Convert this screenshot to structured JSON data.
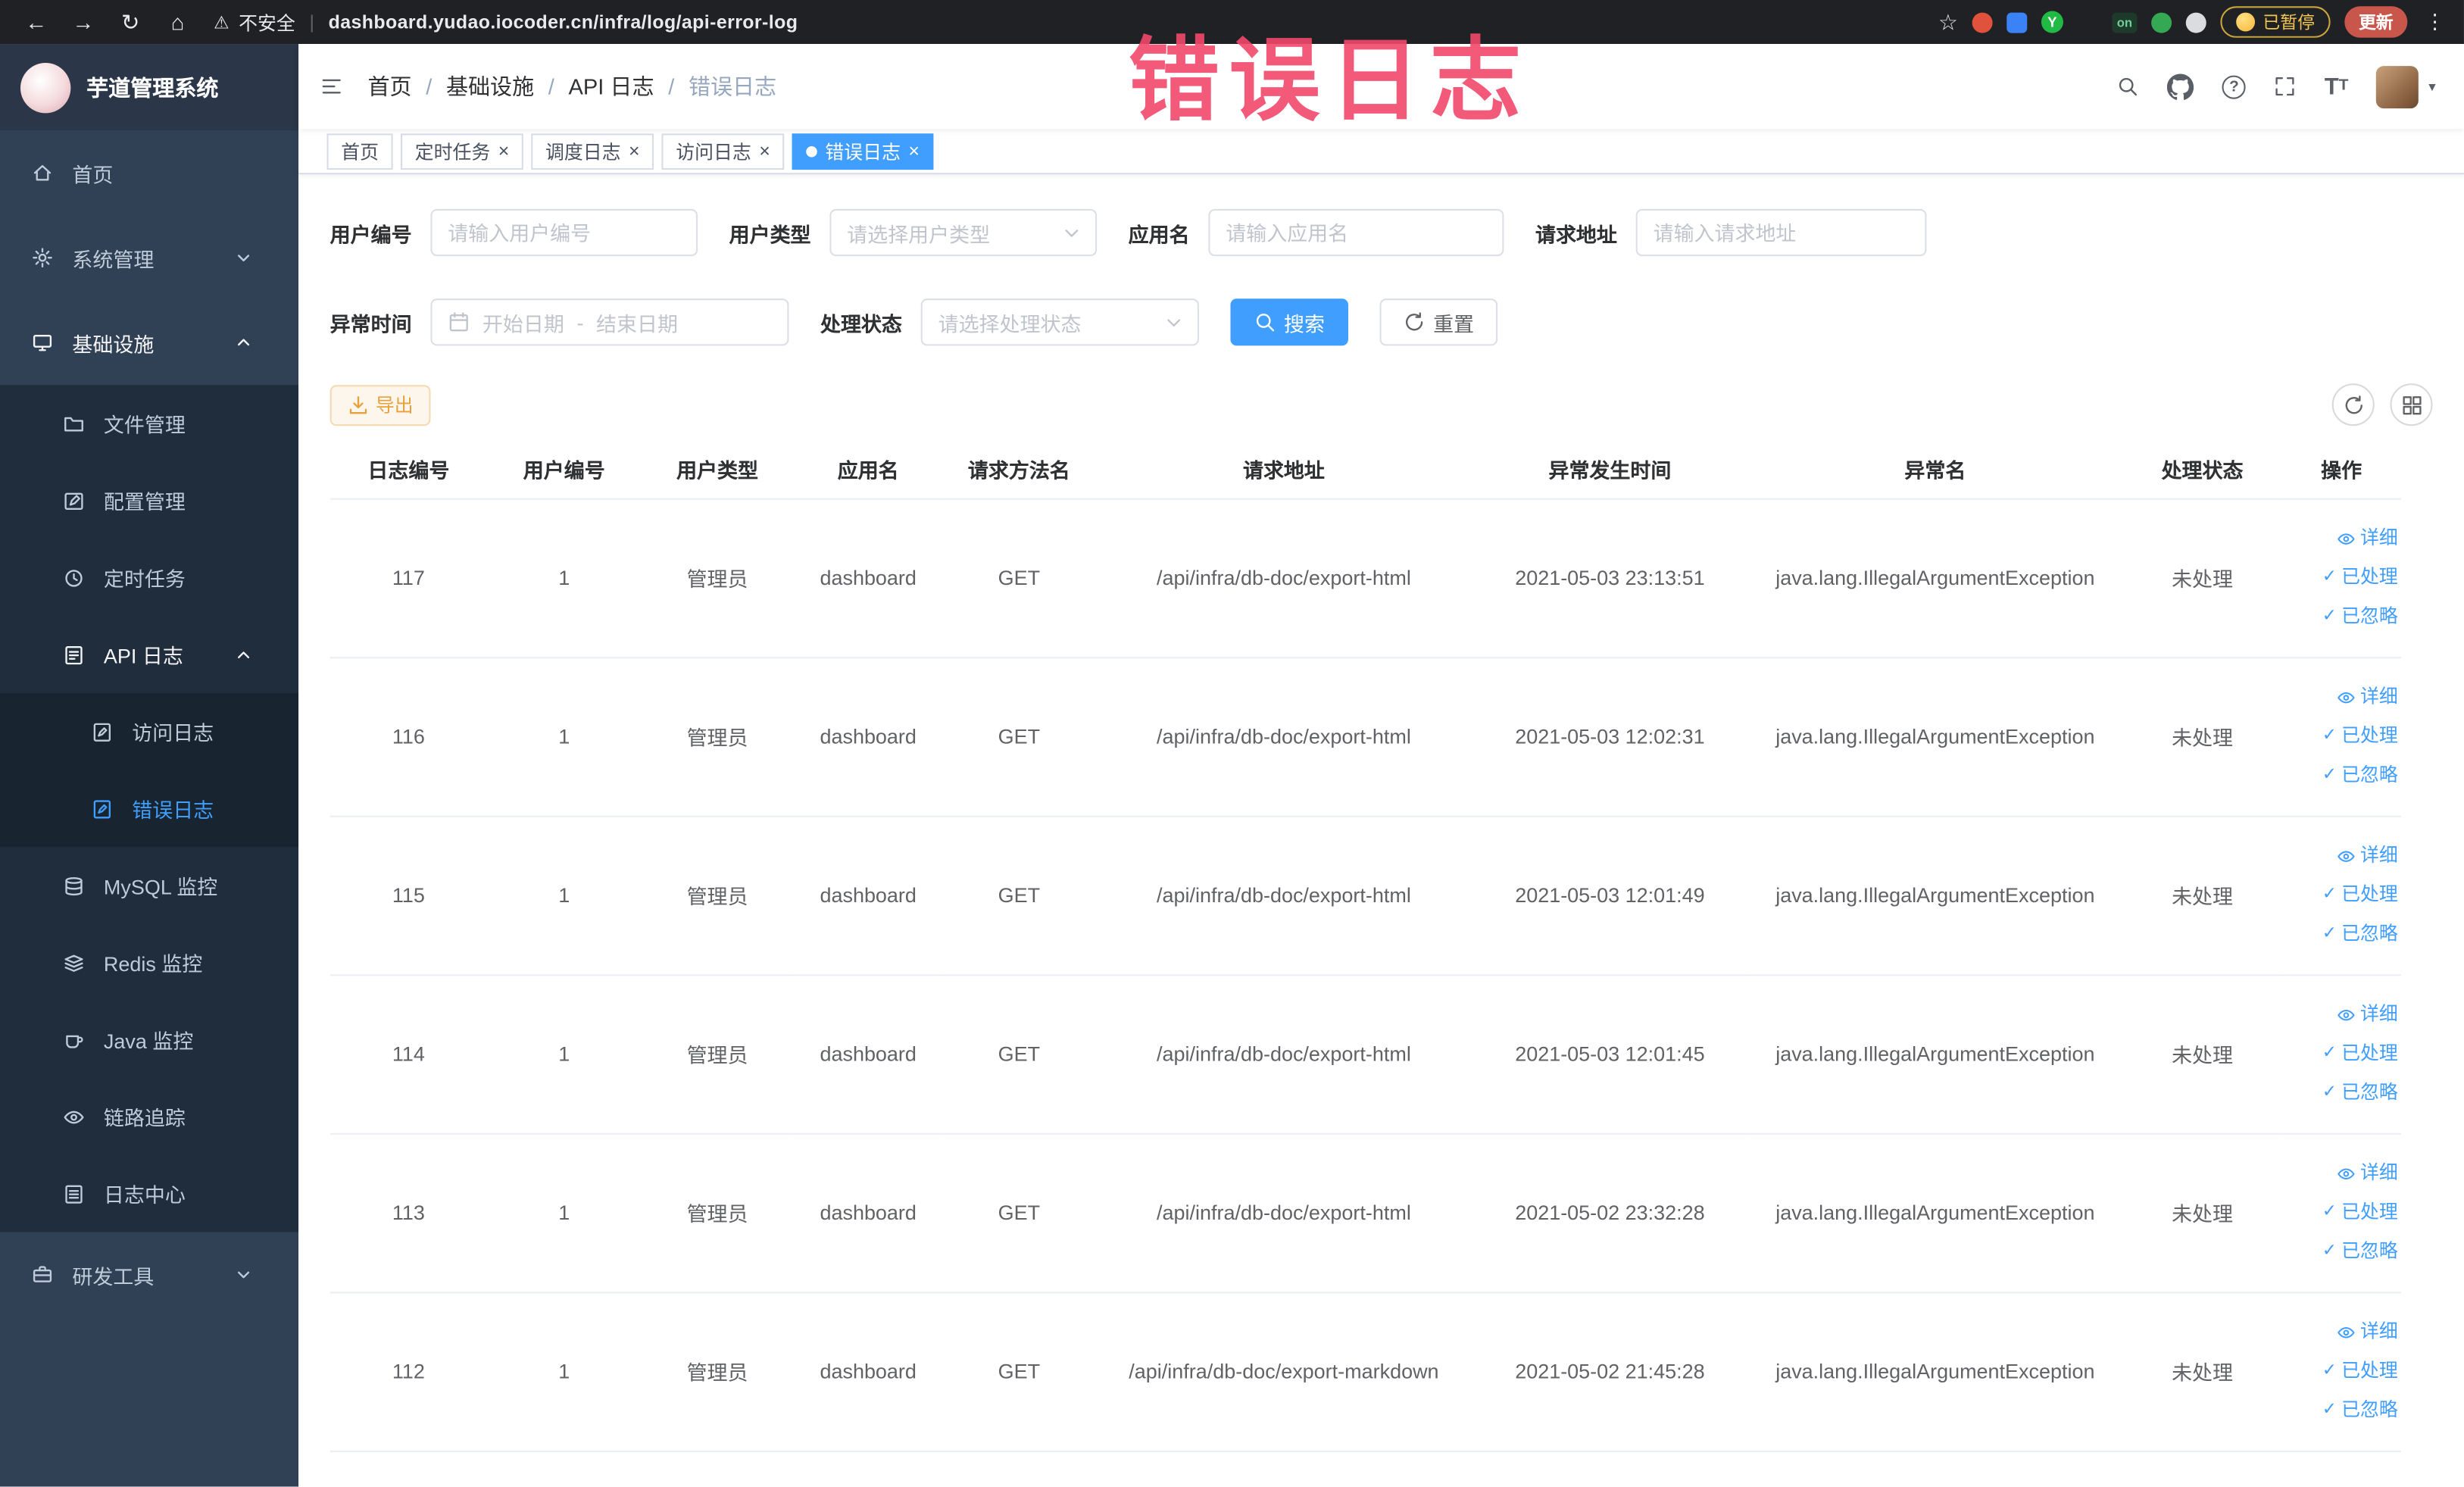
{
  "watermark": "错误日志",
  "colors": {
    "accent": "#409eff",
    "warning": "#e6a23c",
    "sidebar_bg": "#304156",
    "watermark": "#f2486c",
    "tag_active": "#409eff"
  },
  "browser": {
    "security": "不安全",
    "url": "dashboard.yudao.iocoder.cn/infra/log/api-error-log",
    "paused": "已暂停",
    "update": "更新"
  },
  "icons": {
    "back": "←",
    "forward": "→",
    "refresh": "↻",
    "home": "⌂",
    "warning": "⚠",
    "star": "☆",
    "menu": "⋮",
    "close": "×",
    "check": "✓",
    "on_badge": "on",
    "yudao_letter": "Y",
    "breadcrumb_separator": "/",
    "caret": "▾",
    "question": "?",
    "font_size": "T"
  },
  "app": {
    "logo_title": "芋道管理系统",
    "breadcrumb": [
      "首页",
      "基础设施",
      "API 日志",
      "错误日志"
    ]
  },
  "sidebar": {
    "items": [
      {
        "label": "首页"
      },
      {
        "label": "系统管理"
      },
      {
        "label": "基础设施"
      },
      {
        "label": "文件管理"
      },
      {
        "label": "配置管理"
      },
      {
        "label": "定时任务"
      },
      {
        "label": "API 日志"
      },
      {
        "label": "访问日志"
      },
      {
        "label": "错误日志"
      },
      {
        "label": "MySQL 监控"
      },
      {
        "label": "Redis 监控"
      },
      {
        "label": "Java 监控"
      },
      {
        "label": "链路追踪"
      },
      {
        "label": "日志中心"
      },
      {
        "label": "研发工具"
      }
    ]
  },
  "tabs": [
    {
      "label": "首页"
    },
    {
      "label": "定时任务"
    },
    {
      "label": "调度日志"
    },
    {
      "label": "访问日志"
    },
    {
      "label": "错误日志"
    }
  ],
  "filters": {
    "user_id_label": "用户编号",
    "user_id_placeholder": "请输入用户编号",
    "user_type_label": "用户类型",
    "user_type_placeholder": "请选择用户类型",
    "app_name_label": "应用名",
    "app_name_placeholder": "请输入应用名",
    "request_url_label": "请求地址",
    "request_url_placeholder": "请输入请求地址",
    "exception_time_label": "异常时间",
    "date_start_placeholder": "开始日期",
    "date_separator": "-",
    "date_end_placeholder": "结束日期",
    "process_status_label": "处理状态",
    "process_status_placeholder": "请选择处理状态",
    "search_button": "搜索",
    "reset_button": "重置"
  },
  "toolbar": {
    "export_button": "导出"
  },
  "table": {
    "columns": [
      "日志编号",
      "用户编号",
      "用户类型",
      "应用名",
      "请求方法名",
      "请求地址",
      "异常发生时间",
      "异常名",
      "处理状态",
      "操作"
    ],
    "actions": {
      "detail": "详细",
      "processed": "已处理",
      "ignored": "已忽略"
    },
    "rows": [
      {
        "id": "117",
        "user_id": "1",
        "user_type": "管理员",
        "app": "dashboard",
        "method": "GET",
        "url": "/api/infra/db-doc/export-html",
        "time": "2021-05-03 23:13:51",
        "exception": "java.lang.IllegalArgumentException",
        "status": "未处理"
      },
      {
        "id": "116",
        "user_id": "1",
        "user_type": "管理员",
        "app": "dashboard",
        "method": "GET",
        "url": "/api/infra/db-doc/export-html",
        "time": "2021-05-03 12:02:31",
        "exception": "java.lang.IllegalArgumentException",
        "status": "未处理"
      },
      {
        "id": "115",
        "user_id": "1",
        "user_type": "管理员",
        "app": "dashboard",
        "method": "GET",
        "url": "/api/infra/db-doc/export-html",
        "time": "2021-05-03 12:01:49",
        "exception": "java.lang.IllegalArgumentException",
        "status": "未处理"
      },
      {
        "id": "114",
        "user_id": "1",
        "user_type": "管理员",
        "app": "dashboard",
        "method": "GET",
        "url": "/api/infra/db-doc/export-html",
        "time": "2021-05-03 12:01:45",
        "exception": "java.lang.IllegalArgumentException",
        "status": "未处理"
      },
      {
        "id": "113",
        "user_id": "1",
        "user_type": "管理员",
        "app": "dashboard",
        "method": "GET",
        "url": "/api/infra/db-doc/export-html",
        "time": "2021-05-02 23:32:28",
        "exception": "java.lang.IllegalArgumentException",
        "status": "未处理"
      },
      {
        "id": "112",
        "user_id": "1",
        "user_type": "管理员",
        "app": "dashboard",
        "method": "GET",
        "url": "/api/infra/db-doc/export-markdown",
        "time": "2021-05-02 21:45:28",
        "exception": "java.lang.IllegalArgumentException",
        "status": "未处理"
      }
    ]
  }
}
